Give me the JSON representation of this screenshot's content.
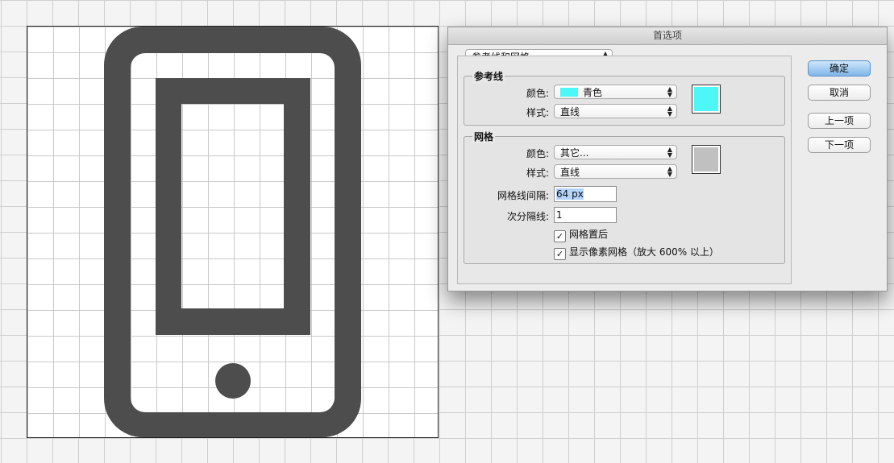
{
  "dialog": {
    "title": "首选项",
    "section_select": "参考线和网格",
    "guides": {
      "legend": "参考线",
      "color_label": "颜色:",
      "color_value": "青色",
      "color_hex": "#4ef7f7",
      "style_label": "样式:",
      "style_value": "直线"
    },
    "grid": {
      "legend": "网格",
      "color_label": "颜色:",
      "color_value": "其它...",
      "color_hex": "#c0c0c0",
      "style_label": "样式:",
      "style_value": "直线",
      "gridline_label": "网格线间隔:",
      "gridline_value": "64 px",
      "subdiv_label": "次分隔线:",
      "subdiv_value": "1",
      "grid_behind_label": "网格置后",
      "grid_behind_checked": true,
      "pixel_grid_label": "显示像素网格（放大 600% 以上）",
      "pixel_grid_checked": true
    },
    "buttons": {
      "ok": "确定",
      "cancel": "取消",
      "prev": "上一项",
      "next": "下一项"
    }
  },
  "icons": {
    "arrows": "▲▼",
    "check": "✓"
  },
  "canvas": {
    "icon_color": "#4d4d4d"
  }
}
